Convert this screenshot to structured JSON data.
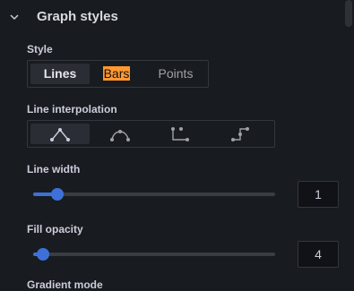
{
  "section": {
    "title": "Graph styles"
  },
  "style": {
    "label": "Style",
    "options": [
      "Lines",
      "Bars",
      "Points"
    ],
    "selected": "Lines"
  },
  "interpolation": {
    "label": "Line interpolation",
    "options": [
      "linear-icon",
      "smooth-icon",
      "step-before-icon",
      "step-after-icon"
    ],
    "selected": "linear-icon"
  },
  "line_width": {
    "label": "Line width",
    "value": "1",
    "slider_fraction": 0.1
  },
  "fill_opacity": {
    "label": "Fill opacity",
    "value": "4",
    "slider_fraction": 0.04
  },
  "next_label_partial": "Gradient mode"
}
